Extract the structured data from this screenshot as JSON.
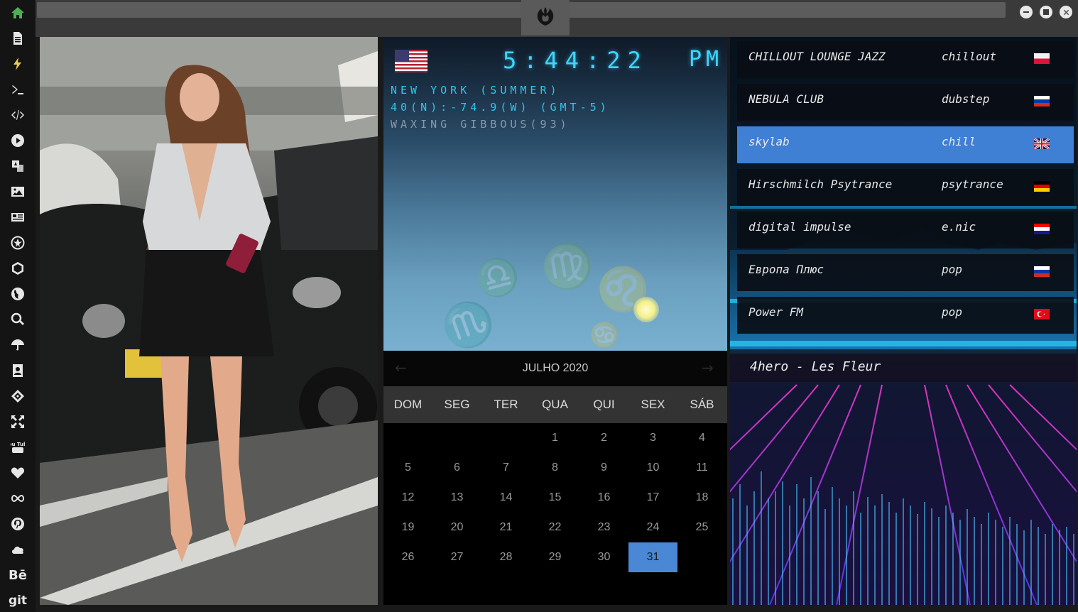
{
  "sidebar": {
    "items": [
      {
        "name": "home-icon"
      },
      {
        "name": "document-icon"
      },
      {
        "name": "lightning-icon"
      },
      {
        "name": "terminal-icon"
      },
      {
        "name": "code-icon"
      },
      {
        "name": "play-icon"
      },
      {
        "name": "translate-icon"
      },
      {
        "name": "image-icon"
      },
      {
        "name": "news-icon"
      },
      {
        "name": "rebel-icon"
      },
      {
        "name": "hexagon-icon"
      },
      {
        "name": "globe-icon"
      },
      {
        "name": "search-icon"
      },
      {
        "name": "umbrella-icon"
      },
      {
        "name": "contact-icon"
      },
      {
        "name": "codepen-icon"
      },
      {
        "name": "expand-icon"
      },
      {
        "name": "youtube-icon"
      },
      {
        "name": "heart-icon"
      },
      {
        "name": "infinity-icon"
      },
      {
        "name": "pinterest-icon"
      },
      {
        "name": "cloud-icon"
      },
      {
        "name": "behance-icon"
      },
      {
        "name": "git-icon"
      }
    ],
    "behance_text": "Bē",
    "git_text": "git",
    "youtube_text": "You Tube",
    "accent": "#4caf50"
  },
  "clock": {
    "time": "5:44:22",
    "ampm": "PM",
    "location": "NEW YORK (SUMMER)",
    "coords": "40(N):-74.9(W) (GMT-5)",
    "moon": "WAXING GIBBOUS(93)"
  },
  "calendar": {
    "month": "JULHO 2020",
    "prev": "←",
    "next": "→",
    "weekdays": [
      "DOM",
      "SEG",
      "TER",
      "QUA",
      "QUI",
      "SEX",
      "SÁB"
    ],
    "weeks": [
      [
        "",
        "",
        "",
        "1",
        "2",
        "3",
        "4"
      ],
      [
        "5",
        "6",
        "7",
        "8",
        "9",
        "10",
        "11"
      ],
      [
        "12",
        "13",
        "14",
        "15",
        "16",
        "17",
        "18"
      ],
      [
        "19",
        "20",
        "21",
        "22",
        "23",
        "24",
        "25"
      ],
      [
        "26",
        "27",
        "28",
        "29",
        "30",
        "31",
        ""
      ]
    ],
    "today": "31",
    "today_color": "#4a88d6"
  },
  "radio": {
    "stations": [
      {
        "name": "CHILLOUT LOUNGE JAZZ",
        "genre": "chillout",
        "flag": "poland"
      },
      {
        "name": "NEBULA CLUB",
        "genre": "dubstep",
        "flag": "russia"
      },
      {
        "name": "skylab",
        "genre": "chill",
        "flag": "uk"
      },
      {
        "name": "Hirschmilch Psytrance",
        "genre": "psytrance",
        "flag": "germany"
      },
      {
        "name": "digital impulse",
        "genre": "e.nic",
        "flag": "croatia"
      },
      {
        "name": "Европа Плюс",
        "genre": "pop",
        "flag": "russia"
      },
      {
        "name": "Power FM",
        "genre": "pop",
        "flag": "turkey"
      }
    ],
    "selected_index": 2,
    "selected_color": "#3f7fd4",
    "now_playing": "4hero - Les Fleur"
  }
}
